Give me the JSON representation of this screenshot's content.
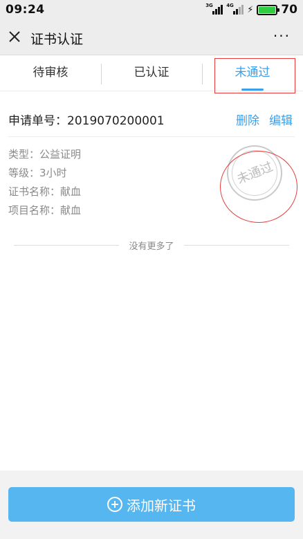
{
  "status_bar": {
    "time": "09:24",
    "network_1": "3G",
    "network_2": "4G",
    "battery": "70"
  },
  "nav": {
    "title": "证书认证",
    "more": "···"
  },
  "tabs": [
    {
      "label": "待审核",
      "active": false
    },
    {
      "label": "已认证",
      "active": false
    },
    {
      "label": "未通过",
      "active": true
    }
  ],
  "record": {
    "application_no": "申请单号：2019070200001",
    "actions": {
      "delete": "删除",
      "edit": "编辑"
    },
    "details": [
      "类型：公益证明",
      "等级：3小时",
      "证书名称：献血",
      "项目名称：献血"
    ],
    "stamp": "未通过"
  },
  "list_end": "没有更多了",
  "footer": {
    "add_button": "添加新证书"
  },
  "colors": {
    "accent": "#3aa0ec",
    "button": "#55b6f0",
    "annotation": "#e83a3a"
  }
}
